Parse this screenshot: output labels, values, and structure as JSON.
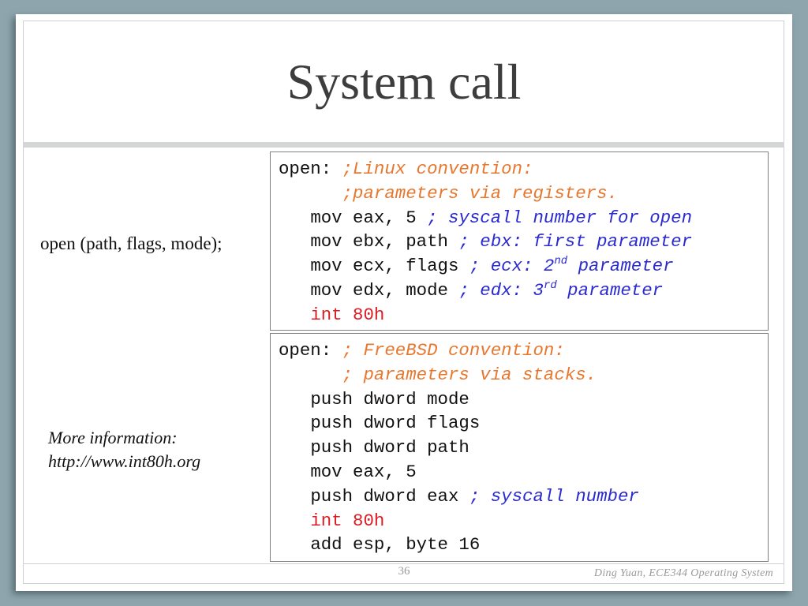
{
  "slide": {
    "title": "System call",
    "signature": "open (path, flags, mode);",
    "more_info": {
      "label": "More information:",
      "url": "http://www.int80h.org"
    },
    "page_number": "36",
    "footer": "Ding Yuan, ECE344 Operating System"
  },
  "colors": {
    "background": "#8ea5ad",
    "comment_header": "#e8772e",
    "comment_inline": "#2a2ad0",
    "interrupt": "#dd1c24",
    "title": "#3d3d3d"
  },
  "linux_code": {
    "l0_label": "open: ",
    "l0_comment": ";Linux convention:",
    "l1_comment": ";parameters via registers.",
    "l2_code": "mov eax, 5 ",
    "l2_comment": "; syscall number for open",
    "l3_code": "mov ebx, path ",
    "l3_comment": "; ebx: first parameter",
    "l4_code": "mov ecx, flags ",
    "l4_comment_a": "; ecx: 2",
    "l4_sup": "nd",
    "l4_comment_b": " parameter",
    "l5_code": "mov edx, mode ",
    "l5_comment_a": "; edx: 3",
    "l5_sup": "rd",
    "l5_comment_b": " parameter",
    "l6_code": "int 80h"
  },
  "bsd_code": {
    "l0_label": "open: ",
    "l0_comment": "; FreeBSD convention:",
    "l1_comment": "; parameters via stacks.",
    "l2_code": "push dword mode",
    "l3_code": "push dword flags",
    "l4_code": "push dword path",
    "l5_code": "mov eax, 5",
    "l6_code": "push dword eax ",
    "l6_comment": "; syscall number",
    "l7_code": "int 80h",
    "l8_code": "add esp, byte 16"
  }
}
